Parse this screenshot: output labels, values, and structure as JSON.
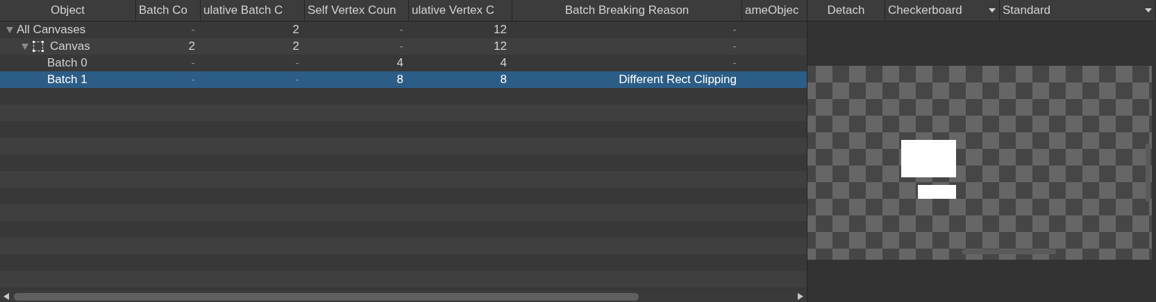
{
  "table": {
    "columns": [
      {
        "label": "Object"
      },
      {
        "label": "Batch Co"
      },
      {
        "label": "ulative Batch C"
      },
      {
        "label": "Self Vertex Coun"
      },
      {
        "label": "ulative Vertex C"
      },
      {
        "label": "Batch Breaking Reason"
      },
      {
        "label": "ameObjec"
      }
    ],
    "rows": [
      {
        "name": "All Canvases",
        "kind": "group",
        "expanded": true,
        "selected": false,
        "cells": [
          "-",
          "2",
          "-",
          "12",
          "-"
        ],
        "children": [
          {
            "name": "Canvas",
            "kind": "canvas",
            "expanded": true,
            "selected": false,
            "cells": [
              "2",
              "2",
              "-",
              "12",
              "-"
            ],
            "children": [
              {
                "name": "Batch 0",
                "kind": "batch",
                "selected": false,
                "cells": [
                  "-",
                  "-",
                  "4",
                  "4",
                  "-"
                ]
              },
              {
                "name": "Batch 1",
                "kind": "batch",
                "selected": true,
                "cells": [
                  "-",
                  "-",
                  "8",
                  "8",
                  "Different Rect Clipping"
                ]
              }
            ]
          }
        ]
      }
    ]
  },
  "preview": {
    "toolbar": [
      {
        "kind": "button",
        "label": "Detach"
      },
      {
        "kind": "dropdown",
        "label": "Checkerboard"
      },
      {
        "kind": "dropdown",
        "label": "Standard"
      }
    ]
  }
}
